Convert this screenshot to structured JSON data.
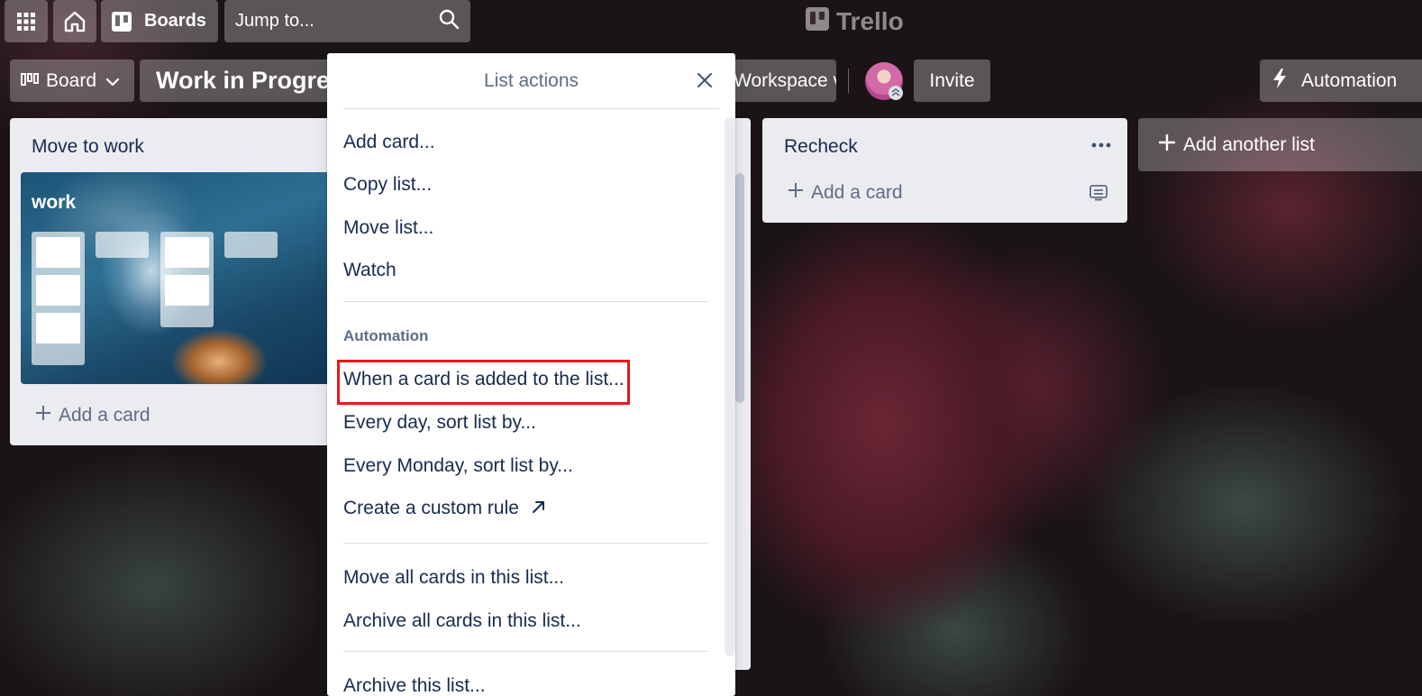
{
  "header": {
    "apps_icon": "grid-icon",
    "home_icon": "home-icon",
    "boards_label": "Boards",
    "search_placeholder": "Jump to...",
    "search_icon": "search-icon",
    "logo_text": "Trello"
  },
  "board_header": {
    "view_label": "Board",
    "title": "Work in Progress",
    "visibility_label": "Workspace visible",
    "invite_label": "Invite",
    "automation_label": "Automation"
  },
  "lists": [
    {
      "title": "Move to work",
      "card": {
        "title": "work"
      },
      "add_card_label": "Add a card"
    },
    {
      "title": "Recheck",
      "menu_icon": "more-icon",
      "add_card_label": "Add a card",
      "template_icon": "card-template-icon"
    }
  ],
  "add_list_label": "Add another list",
  "popover": {
    "title": "List actions",
    "close_icon": "close-icon",
    "group1": [
      "Add card...",
      "Copy list...",
      "Move list...",
      "Watch"
    ],
    "automation_heading": "Automation",
    "automation_items": [
      "When a card is added to the list...",
      "Every day, sort list by...",
      "Every Monday, sort list by...",
      "Create a custom rule"
    ],
    "external_icon": "arrow-up-right-icon",
    "group3": [
      "Move all cards in this list...",
      "Archive all cards in this list..."
    ],
    "group4": [
      "Archive this list..."
    ]
  },
  "colors": {
    "highlight": "#e31b1b",
    "list_bg": "#ebecf0",
    "text": "#172b4d",
    "muted": "#5e6c84"
  }
}
